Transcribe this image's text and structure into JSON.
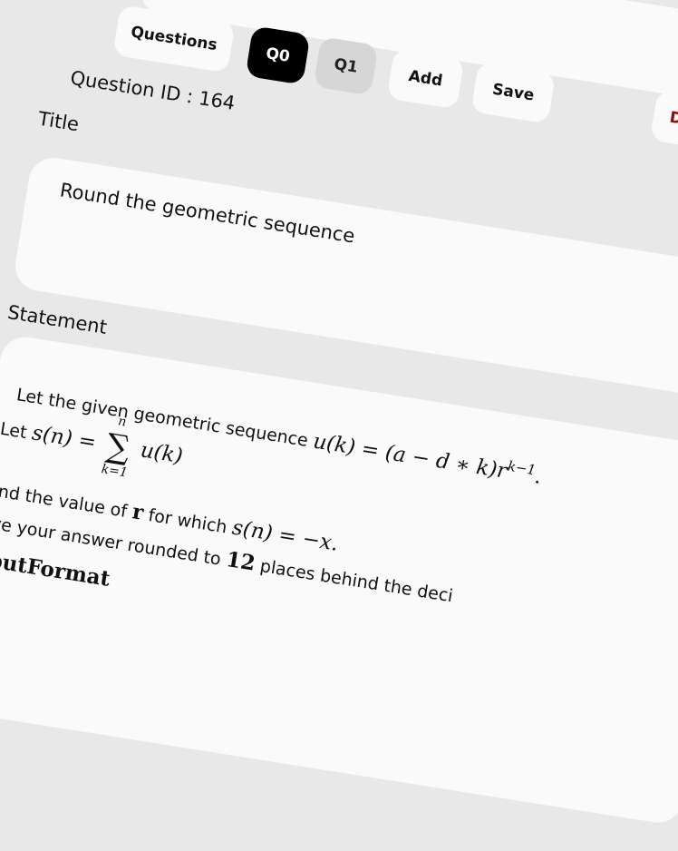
{
  "toolbar": {
    "questions_label": "Questions",
    "tabs": [
      "Q0",
      "Q1"
    ],
    "add_label": "Add",
    "save_label": "Save",
    "delete_label": "DELETE"
  },
  "question": {
    "id_label": "Question ID : 164",
    "title_label": "Title",
    "title_value": "Round the geometric sequence",
    "statement_label": "Statement"
  },
  "statement": {
    "line1_text": "Let the given geometric sequence",
    "line1_math": "u(k) = (a − d ∗ k)r",
    "line1_exp": "k−1",
    "line1_end": ".",
    "line2_prefix": "Let",
    "line2_math_lhs": "s(n) =",
    "sum_upper": "n",
    "sum_symbol": "∑",
    "sum_lower": "k=1",
    "line2_math_rhs": "u(k)",
    "line3_text_a": "FInd the value of",
    "line3_var": "r",
    "line3_text_b": "for which",
    "line3_math": "s(n) = −x.",
    "line4_text_a": "GIve your answer rounded to",
    "line4_num": "12",
    "line4_text_b": "places behind the deci",
    "input_format": "InputFormat"
  }
}
